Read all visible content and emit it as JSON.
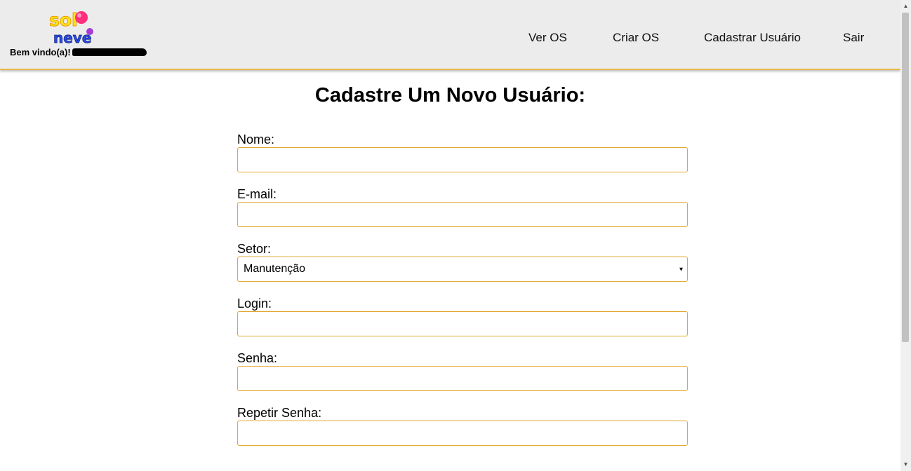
{
  "header": {
    "logo_text": "sol neve",
    "welcome": "Bem vindo(a)!",
    "nav": [
      "Ver OS",
      "Criar OS",
      "Cadastrar Usuário",
      "Sair"
    ]
  },
  "main": {
    "title": "Cadastre Um Novo Usuário:",
    "fields": {
      "nome": {
        "label": "Nome:",
        "value": ""
      },
      "email": {
        "label": "E-mail:",
        "value": ""
      },
      "setor": {
        "label": "Setor:",
        "selected": "Manutenção"
      },
      "login": {
        "label": "Login:",
        "value": ""
      },
      "senha": {
        "label": "Senha:",
        "value": ""
      },
      "repetir_senha": {
        "label": "Repetir Senha:",
        "value": ""
      }
    }
  },
  "colors": {
    "navbar_bg": "#ececec",
    "accent_border": "#e3a72f"
  },
  "icons": {
    "select_caret": "▾",
    "scroll_up": "▲",
    "scroll_down": "▼"
  }
}
